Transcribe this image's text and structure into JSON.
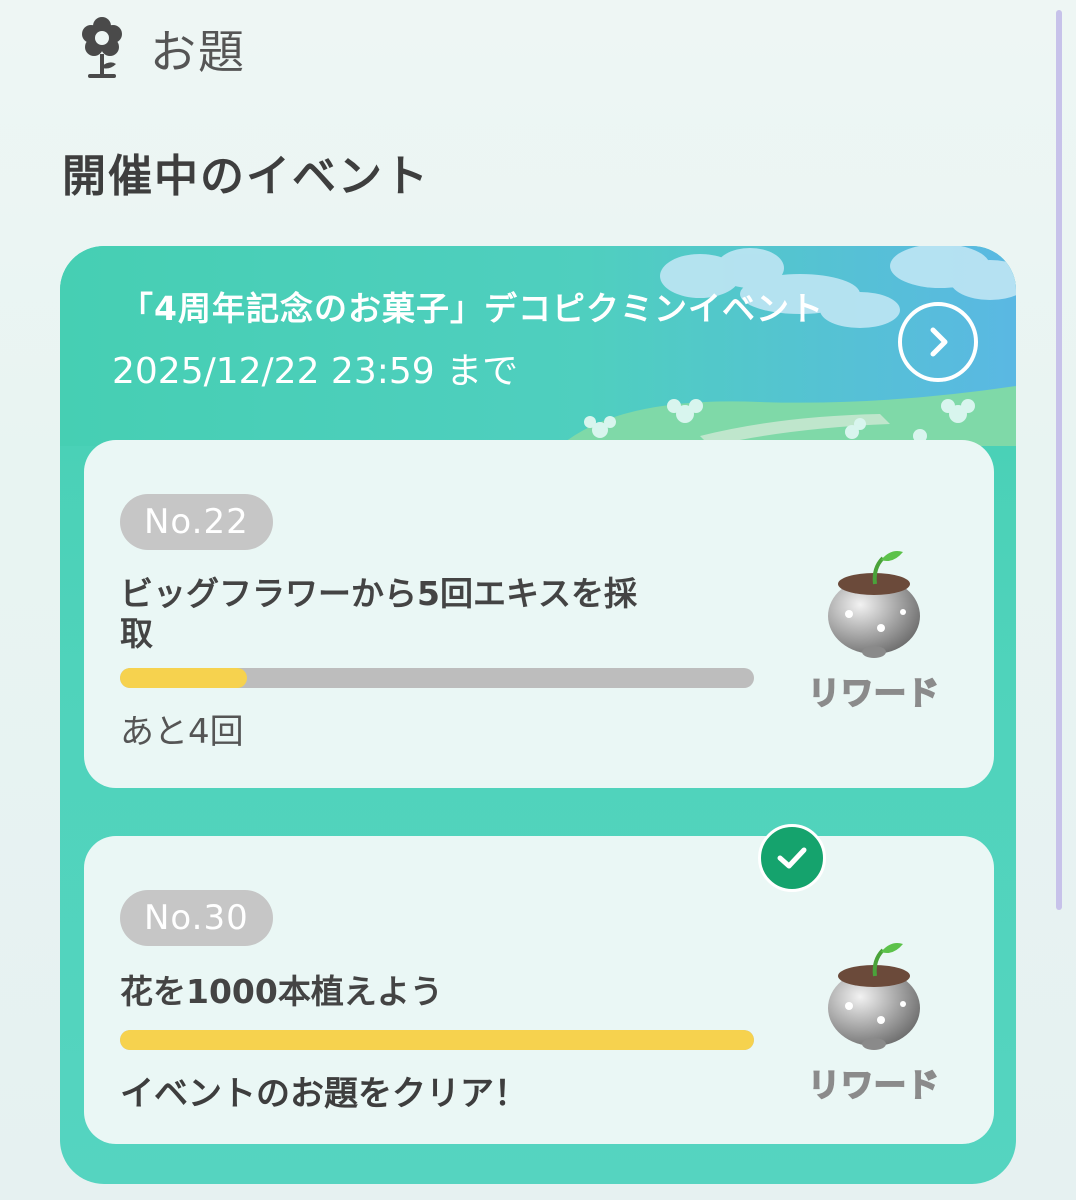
{
  "header": {
    "title": "お題",
    "icon": "flower-icon"
  },
  "section": {
    "title": "開催中のイベント"
  },
  "event": {
    "name": "「4周年記念のお菓子」デコピクミンイベント",
    "deadline": "2025/12/22 23:59 まで",
    "detail_icon": "chevron-right-icon"
  },
  "missions": [
    {
      "number": "No.22",
      "title_line1": "ビッグフラワーから5回エキスを採",
      "title_line2": "取",
      "progress": 0.2,
      "status": "あと4回",
      "reward_label": "リワード",
      "reward_icon": "seedling-pot-icon",
      "completed": false
    },
    {
      "number": "No.30",
      "title_line1": "花を1000本植えよう",
      "progress": 1.0,
      "status": "イベントのお題をクリア！",
      "reward_label": "リワード",
      "reward_icon": "seedling-pot-icon",
      "completed": true
    }
  ],
  "colors": {
    "card": "#4fd3bb",
    "progress_fill": "#f6d24e",
    "progress_track": "#bdbdbd",
    "check": "#15a36d"
  }
}
